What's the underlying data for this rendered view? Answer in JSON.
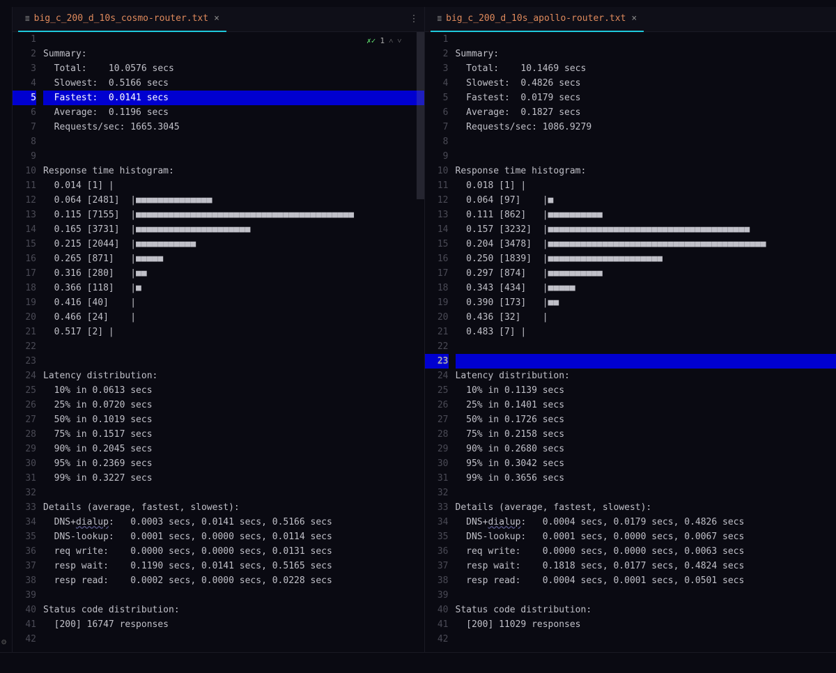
{
  "left": {
    "tab_name": "big_c_200_d_10s_cosmo-router.txt",
    "highlight_line": 5,
    "lines": [
      "",
      "Summary:",
      "  Total:    10.0576 secs",
      "  Slowest:  0.5166 secs",
      "  Fastest:  0.0141 secs",
      "  Average:  0.1196 secs",
      "  Requests/sec: 1665.3045",
      "",
      "",
      "Response time histogram:",
      "  0.014 [1] |",
      "  0.064 [2481]  |■■■■■■■■■■■■■■",
      "  0.115 [7155]  |■■■■■■■■■■■■■■■■■■■■■■■■■■■■■■■■■■■■■■■■",
      "  0.165 [3731]  |■■■■■■■■■■■■■■■■■■■■■",
      "  0.215 [2044]  |■■■■■■■■■■■",
      "  0.265 [871]   |■■■■■",
      "  0.316 [280]   |■■",
      "  0.366 [118]   |■",
      "  0.416 [40]    |",
      "  0.466 [24]    |",
      "  0.517 [2] |",
      "",
      "",
      "Latency distribution:",
      "  10% in 0.0613 secs",
      "  25% in 0.0720 secs",
      "  50% in 0.1019 secs",
      "  75% in 0.1517 secs",
      "  90% in 0.2045 secs",
      "  95% in 0.2369 secs",
      "  99% in 0.3227 secs",
      "",
      "Details (average, fastest, slowest):",
      "  DNS+dialup:   0.0003 secs, 0.0141 secs, 0.5166 secs",
      "  DNS-lookup:   0.0001 secs, 0.0000 secs, 0.0114 secs",
      "  req write:    0.0000 secs, 0.0000 secs, 0.0131 secs",
      "  resp wait:    0.1190 secs, 0.0141 secs, 0.5165 secs",
      "  resp read:    0.0002 secs, 0.0000 secs, 0.0228 secs",
      "",
      "Status code distribution:",
      "  [200] 16747 responses",
      ""
    ]
  },
  "right": {
    "tab_name": "big_c_200_d_10s_apollo-router.txt",
    "highlight_line": 23,
    "lines": [
      "",
      "Summary:",
      "  Total:    10.1469 secs",
      "  Slowest:  0.4826 secs",
      "  Fastest:  0.0179 secs",
      "  Average:  0.1827 secs",
      "  Requests/sec: 1086.9279",
      "",
      "",
      "Response time histogram:",
      "  0.018 [1] |",
      "  0.064 [97]    |■",
      "  0.111 [862]   |■■■■■■■■■■",
      "  0.157 [3232]  |■■■■■■■■■■■■■■■■■■■■■■■■■■■■■■■■■■■■■",
      "  0.204 [3478]  |■■■■■■■■■■■■■■■■■■■■■■■■■■■■■■■■■■■■■■■■",
      "  0.250 [1839]  |■■■■■■■■■■■■■■■■■■■■■",
      "  0.297 [874]   |■■■■■■■■■■",
      "  0.343 [434]   |■■■■■",
      "  0.390 [173]   |■■",
      "  0.436 [32]    |",
      "  0.483 [7] |",
      "",
      "",
      "Latency distribution:",
      "  10% in 0.1139 secs",
      "  25% in 0.1401 secs",
      "  50% in 0.1726 secs",
      "  75% in 0.2158 secs",
      "  90% in 0.2680 secs",
      "  95% in 0.3042 secs",
      "  99% in 0.3656 secs",
      "",
      "Details (average, fastest, slowest):",
      "  DNS+dialup:   0.0004 secs, 0.0179 secs, 0.4826 secs",
      "  DNS-lookup:   0.0001 secs, 0.0000 secs, 0.0067 secs",
      "  req write:    0.0000 secs, 0.0000 secs, 0.0063 secs",
      "  resp wait:    0.1818 secs, 0.0177 secs, 0.4824 secs",
      "  resp read:    0.0004 secs, 0.0001 secs, 0.0501 secs",
      "",
      "Status code distribution:",
      "  [200] 11029 responses",
      ""
    ]
  },
  "diff_indicator": {
    "status": "1"
  }
}
